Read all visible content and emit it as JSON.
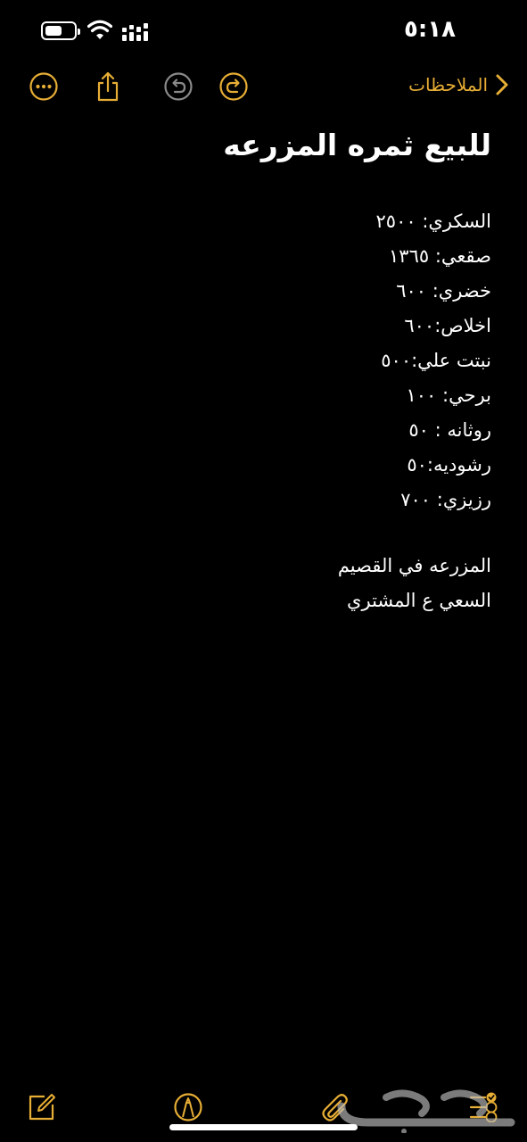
{
  "status_bar": {
    "time": "٥:١٨",
    "battery_level": 0.7
  },
  "toolbar": {
    "back_label": "الملاحظات",
    "icons": [
      "more-icon",
      "share-icon",
      "undo-icon",
      "redo-icon",
      "chevron-right-icon"
    ]
  },
  "note": {
    "title": "للبيع ثمره المزرعه",
    "lines": [
      "السكري: ٢٥٠٠",
      "صقعي: ١٣٦٥",
      "خضري: ٦٠٠",
      "اخلاص:٦٠٠",
      "نبتت علي:٥٠٠",
      "برحي: ١٠٠",
      "روثانه : ٥٠",
      "رشوديه:٥٠",
      "رزيزي: ٧٠٠"
    ],
    "footer_lines": [
      "المزرعه في القصيم",
      "السعي ع المشتري"
    ]
  },
  "bottom_bar": {
    "icons": [
      "compose-icon",
      "markup-icon",
      "attachment-icon",
      "checklist-icon"
    ]
  },
  "colors": {
    "accent": "#E7AE35",
    "background": "#000000",
    "text": "#FFFFFF",
    "disabled": "#8A8A8A"
  }
}
